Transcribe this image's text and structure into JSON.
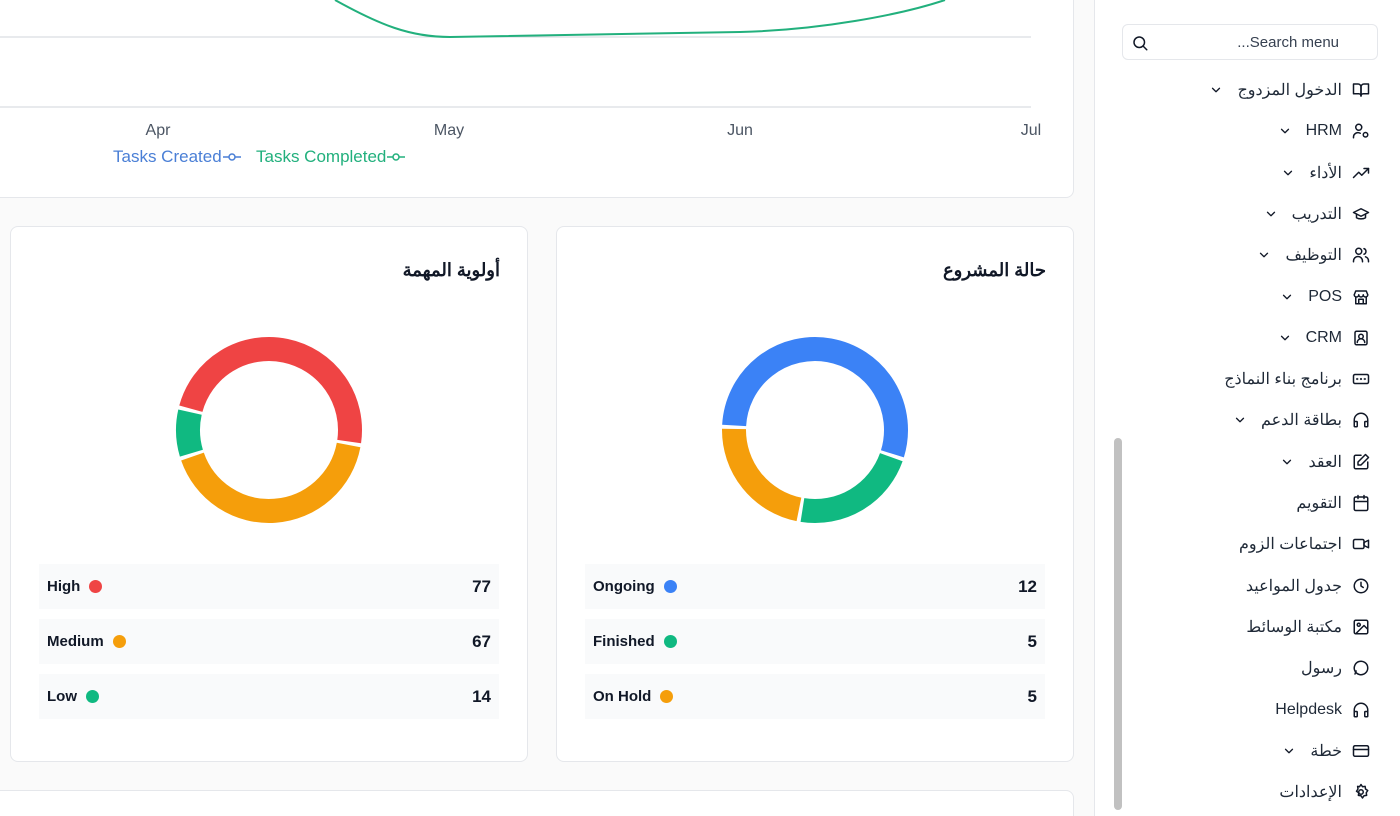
{
  "trend_chart": {
    "x_ticks": [
      "Apr",
      "May",
      "Jun",
      "Jul"
    ],
    "legend": [
      {
        "label": "Tasks Created",
        "color": "#4a7fd6"
      },
      {
        "label": "Tasks Completed",
        "color": "#22b07d"
      }
    ]
  },
  "task_priority": {
    "title": "أولوية المهمة",
    "items": [
      {
        "label": "High",
        "value": "77",
        "color": "#ef4444"
      },
      {
        "label": "Medium",
        "value": "67",
        "color": "#f59e0b"
      },
      {
        "label": "Low",
        "value": "14",
        "color": "#10b981"
      }
    ]
  },
  "project_status": {
    "title": "حالة المشروع",
    "items": [
      {
        "label": "Ongoing",
        "value": "12",
        "color": "#3b82f6"
      },
      {
        "label": "Finished",
        "value": "5",
        "color": "#10b981"
      },
      {
        "label": "On Hold",
        "value": "5",
        "color": "#f59e0b"
      }
    ]
  },
  "chart_data": [
    {
      "type": "pie",
      "title": "أولوية المهمة",
      "categories": [
        "High",
        "Medium",
        "Low"
      ],
      "values": [
        77,
        67,
        14
      ]
    },
    {
      "type": "pie",
      "title": "حالة المشروع",
      "categories": [
        "Ongoing",
        "Finished",
        "On Hold"
      ],
      "values": [
        12,
        5,
        5
      ]
    }
  ],
  "sidebar": {
    "search_placeholder": "Search menu...",
    "items": [
      {
        "label": "الدخول المزدوج",
        "icon": "book-open-icon",
        "chevron": true
      },
      {
        "label": "HRM",
        "icon": "user-cog-icon",
        "chevron": true
      },
      {
        "label": "الأداء",
        "icon": "trending-up-icon",
        "chevron": true
      },
      {
        "label": "التدريب",
        "icon": "graduation-cap-icon",
        "chevron": true
      },
      {
        "label": "التوظيف",
        "icon": "users-icon",
        "chevron": true
      },
      {
        "label": "POS",
        "icon": "store-icon",
        "chevron": true
      },
      {
        "label": "CRM",
        "icon": "contact-icon",
        "chevron": true
      },
      {
        "label": "برنامج بناء النماذج",
        "icon": "form-input-icon",
        "chevron": false
      },
      {
        "label": "بطاقة الدعم",
        "icon": "headphones-icon",
        "chevron": true
      },
      {
        "label": "العقد",
        "icon": "edit-document-icon",
        "chevron": true
      },
      {
        "label": "التقويم",
        "icon": "calendar-icon",
        "chevron": false
      },
      {
        "label": "اجتماعات الزوم",
        "icon": "video-icon",
        "chevron": false
      },
      {
        "label": "جدول المواعيد",
        "icon": "clock-icon",
        "chevron": false
      },
      {
        "label": "مكتبة الوسائط",
        "icon": "image-icon",
        "chevron": false
      },
      {
        "label": "رسول",
        "icon": "message-circle-icon",
        "chevron": false
      },
      {
        "label": "Helpdesk",
        "icon": "headphones-icon",
        "chevron": false
      },
      {
        "label": "خطة",
        "icon": "credit-card-icon",
        "chevron": true
      },
      {
        "label": "الإعدادات",
        "icon": "settings-icon",
        "chevron": false
      }
    ]
  }
}
